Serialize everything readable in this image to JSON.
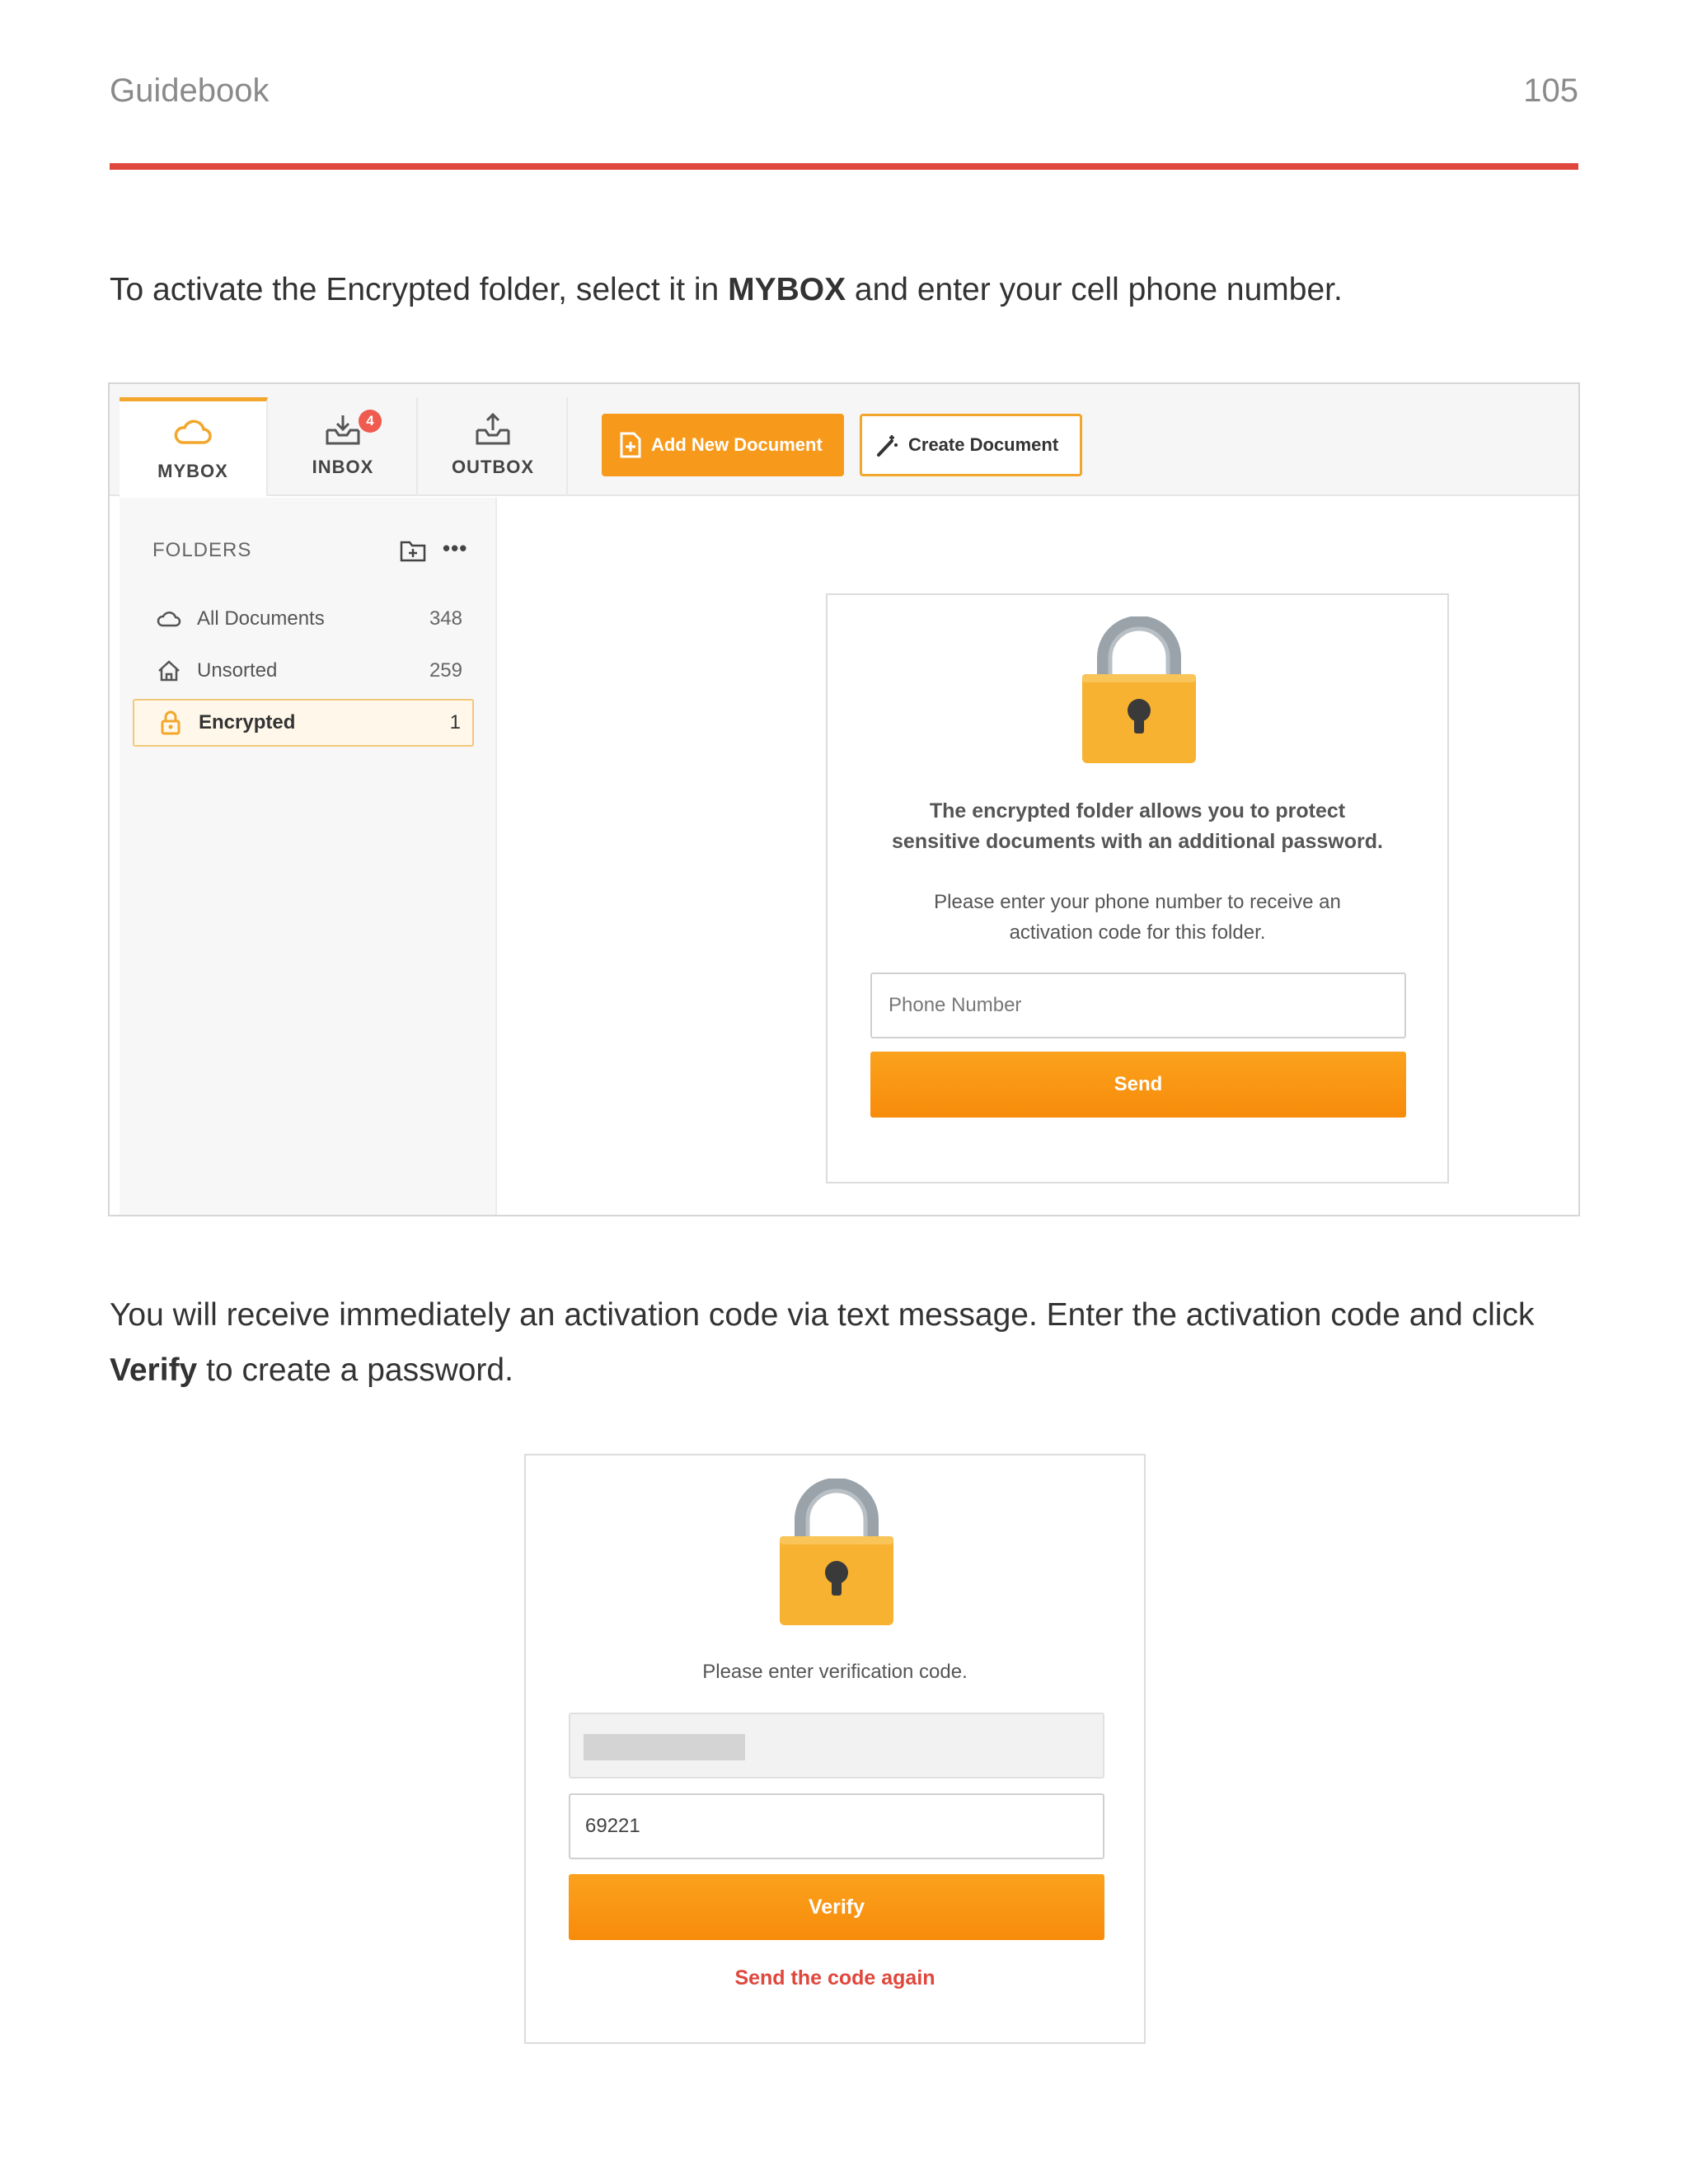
{
  "header": {
    "title": "Guidebook",
    "page_number": "105",
    "rule_color": "#e0473c"
  },
  "paragraph1": {
    "before": "To activate the Encrypted folder, select it in ",
    "bold": "MYBOX",
    "after": " and enter your cell phone number."
  },
  "paragraph2": {
    "before": "You will receive immediately an activation code via text message. Enter the activation code and click ",
    "bold": "Verify",
    "after": " to create a password."
  },
  "app": {
    "accent_color": "#f79a1c",
    "tabs": [
      {
        "label": "MYBOX",
        "icon": "cloud-icon",
        "active": true
      },
      {
        "label": "INBOX",
        "icon": "inbox-download-icon",
        "badge": "4"
      },
      {
        "label": "OUTBOX",
        "icon": "outbox-upload-icon"
      }
    ],
    "add_button": "Add New Document",
    "create_button": "Create Document",
    "folders_title": "FOLDERS",
    "folders": [
      {
        "name": "All Documents",
        "count": "348",
        "icon": "cloud-icon"
      },
      {
        "name": "Unsorted",
        "count": "259",
        "icon": "home-icon"
      },
      {
        "name": "Encrypted",
        "count": "1",
        "icon": "lock-icon",
        "selected": true
      }
    ],
    "card": {
      "line1": "The encrypted folder allows you to protect",
      "line2": "sensitive documents with an additional password.",
      "line3": "Please enter your phone number to receive an",
      "line4": "activation code for this folder.",
      "phone_placeholder": "Phone Number",
      "send_button": "Send"
    }
  },
  "verify": {
    "prompt": "Please enter verification code.",
    "code_value": "69221",
    "verify_button": "Verify",
    "resend_link": "Send the code again"
  }
}
